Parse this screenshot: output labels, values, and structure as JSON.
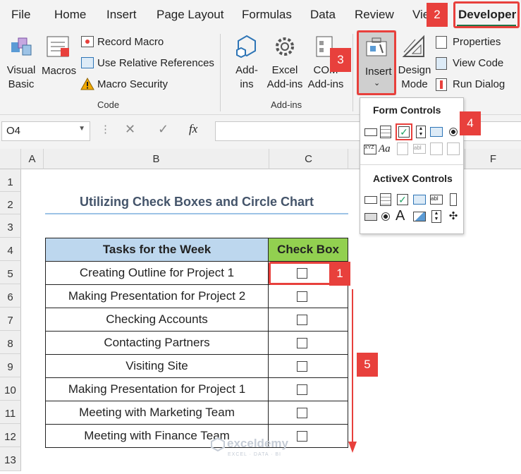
{
  "tabs": [
    "File",
    "Home",
    "Insert",
    "Page Layout",
    "Formulas",
    "Data",
    "Review",
    "Vie",
    "Developer"
  ],
  "ribbon": {
    "visual_basic": [
      "Visual",
      "Basic"
    ],
    "macros": "Macros",
    "record_macro": "Record Macro",
    "relative_refs": "Use Relative References",
    "macro_security": "Macro Security",
    "code_group": "Code",
    "addins": [
      "Add-",
      "ins"
    ],
    "excel_addins": [
      "Excel",
      "Add-ins"
    ],
    "com_addins": [
      "COM",
      "Add-ins"
    ],
    "addins_group": "Add-ins",
    "insert": "Insert",
    "design_mode": [
      "Design",
      "Mode"
    ],
    "properties": "Properties",
    "view_code": "View Code",
    "run_dialog": "Run Dialog"
  },
  "dropdown": {
    "form_controls": "Form Controls",
    "activex_controls": "ActiveX Controls"
  },
  "formula_bar": {
    "name_box": "O4",
    "fx": "fx",
    "formula": ""
  },
  "columns": [
    "A",
    "B",
    "C",
    "F"
  ],
  "rows": [
    "1",
    "2",
    "3",
    "4",
    "5",
    "6",
    "7",
    "8",
    "9",
    "10",
    "11",
    "12",
    "13"
  ],
  "sheet": {
    "title": "Utilizing Check Boxes and Circle Chart",
    "header_tasks": "Tasks for the Week",
    "header_check": "Check Box",
    "tasks": [
      "Creating Outline for Project 1",
      "Making Presentation for Project 2",
      "Checking Accounts",
      "Contacting Partners",
      "Visiting Site",
      "Making Presentation for Project 1",
      "Meeting with Marketing Team",
      "Meeting with Finance Team"
    ]
  },
  "badges": [
    "1",
    "2",
    "3",
    "4",
    "5"
  ],
  "watermark": {
    "brand": "exceldemy",
    "tagline": "EXCEL · DATA · BI"
  },
  "colors": {
    "header_blue": "#bdd7ee",
    "check_green": "#92d050",
    "badge_red": "#e8403c",
    "title_blue": "#44546a",
    "developer_green": "#217346"
  }
}
